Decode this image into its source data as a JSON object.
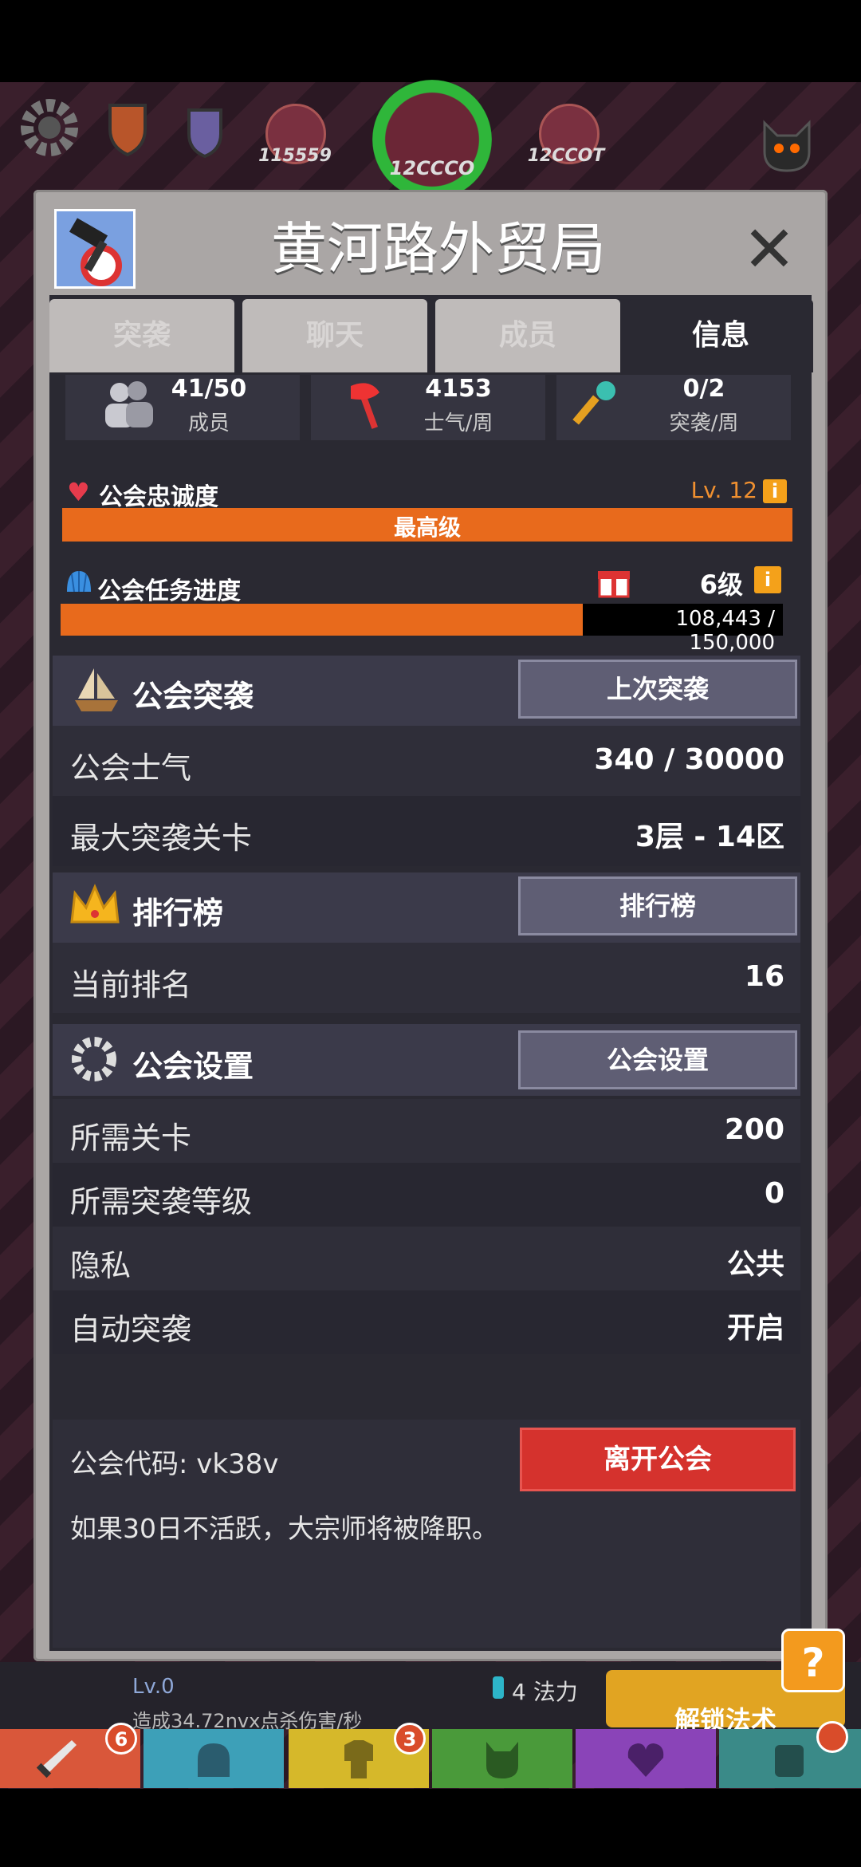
{
  "hud": {
    "boss_left_value": "115559",
    "boss_center_value": "12CCCO",
    "boss_right_value": "12CCOT"
  },
  "modal": {
    "title": "黄河路外贸局",
    "tabs": [
      {
        "label": "突袭"
      },
      {
        "label": "聊天"
      },
      {
        "label": "成员"
      },
      {
        "label": "信息"
      }
    ],
    "stats": [
      {
        "value": "41/50",
        "label": "成员",
        "icon": "members-icon"
      },
      {
        "value": "4153",
        "label": "士气/周",
        "icon": "axe-icon"
      },
      {
        "value": "0/2",
        "label": "突袭/周",
        "icon": "key-icon"
      }
    ],
    "loyalty": {
      "label": "公会忠诚度",
      "level": "Lv. 12",
      "bar_text": "最高级",
      "progress": 1.0
    },
    "quest": {
      "label": "公会任务进度",
      "level": "6级",
      "progress_text": "108,443 / 150,000",
      "progress": 0.723
    },
    "raid": {
      "title": "公会突袭",
      "button": "上次突袭",
      "rows": [
        {
          "label": "公会士气",
          "value": "340 / 30000"
        },
        {
          "label": "最大突袭关卡",
          "value": "3层 - 14区"
        }
      ]
    },
    "ranking": {
      "title": "排行榜",
      "button": "排行榜",
      "rows": [
        {
          "label": "当前排名",
          "value": "16"
        }
      ]
    },
    "settings": {
      "title": "公会设置",
      "button": "公会设置",
      "rows": [
        {
          "label": "所需关卡",
          "value": "200"
        },
        {
          "label": "所需突袭等级",
          "value": "0"
        },
        {
          "label": "隐私",
          "value": "公共"
        },
        {
          "label": "自动突袭",
          "value": "开启"
        }
      ]
    },
    "footer": {
      "code_text": "公会代码: vk38v",
      "leave_button": "离开公会",
      "note": "如果30日不活跃，大宗师将被降职。"
    }
  },
  "bottom": {
    "level": "Lv.0",
    "damage": "造成34.72nvx点杀伤害/秒",
    "mana": "4 法力",
    "unlock": "解锁法术",
    "help": "?",
    "tab_badges": [
      "6",
      "3"
    ]
  },
  "colors": {
    "accent_orange": "#e86a1c",
    "leave_red": "#d5322d",
    "panel_dark": "#2a2932"
  }
}
